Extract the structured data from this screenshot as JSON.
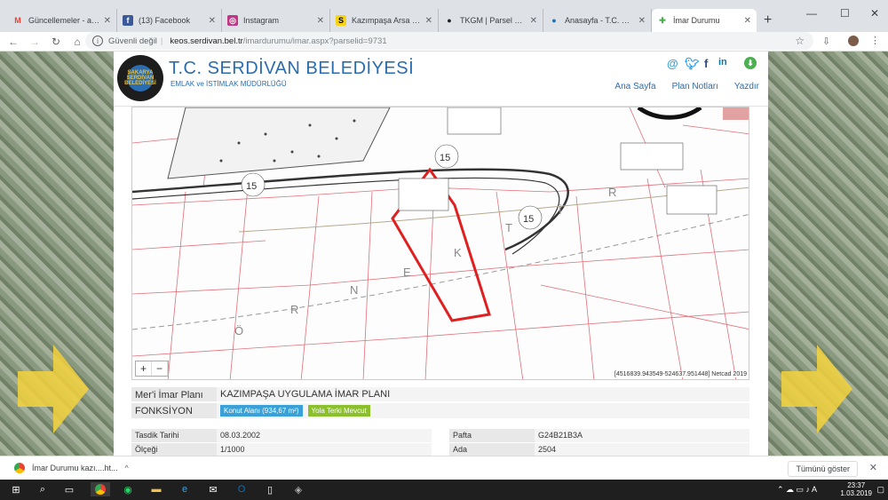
{
  "tabs": [
    {
      "title": "Güncellemeler - alidu",
      "icon": "gmail-icon",
      "icon_glyph": "M",
      "icon_color": "#ea4335"
    },
    {
      "title": "(13) Facebook",
      "icon": "facebook-icon",
      "icon_glyph": "f",
      "icon_color": "#3b5998"
    },
    {
      "title": "Instagram",
      "icon": "instagram-icon",
      "icon_glyph": "◎",
      "icon_color": "#c13584"
    },
    {
      "title": "Kazımpaşa Arsa İlanları",
      "icon": "sahibinden-icon",
      "icon_glyph": "S",
      "icon_color": "#f7d316"
    },
    {
      "title": "TKGM | Parsel Sorgula",
      "icon": "map-pin-icon",
      "icon_glyph": "●",
      "icon_color": "#202124"
    },
    {
      "title": "Anasayfa - T.C. Serdiv",
      "icon": "serdivan-icon",
      "icon_glyph": "●",
      "icon_color": "#2b6cae"
    },
    {
      "title": "İmar Durumu",
      "icon": "netcad-icon",
      "icon_glyph": "✚",
      "icon_color": "#4caf50"
    }
  ],
  "address": {
    "security": "Güvenli değil",
    "host": "keos.serdivan.bel.tr",
    "path": "/imardurumu/imar.aspx?parselid=9731"
  },
  "header": {
    "title": "T.C. SERDİVAN BELEDİYESİ",
    "subtitle": "EMLAK ve İSTİMLAK MÜDÜRLÜĞÜ",
    "logo_text": "SAKARYA SERDİVAN BELEDİYESİ",
    "nav": [
      "Ana Sayfa",
      "Plan Notları",
      "Yazdır"
    ]
  },
  "map": {
    "labels": [
      "Ö",
      "R",
      "N",
      "E",
      "K",
      "T",
      "İ",
      "R"
    ],
    "road_label": "15",
    "coords": "[4516839.943549-524637.951448] Netcad 2019",
    "zoom_in": "+",
    "zoom_out": "−",
    "parcel_color": "#e02020"
  },
  "plan": {
    "plan_label": "Mer'i İmar Planı",
    "plan_value": "KAZIMPAŞA UYGULAMA İMAR PLANI",
    "function_label": "FONKSİYON",
    "function_badges": [
      "Konut Alanı (934,67 m²)",
      "Yola Terki Mevcut"
    ]
  },
  "details": {
    "left": [
      {
        "label": "Tasdik Tarihi",
        "value": "08.03.2002"
      },
      {
        "label": "Ölçeği",
        "value": "1/1000"
      }
    ],
    "right": [
      {
        "label": "Pafta",
        "value": "G24B21B3A"
      },
      {
        "label": "Ada",
        "value": "2504"
      }
    ]
  },
  "download": {
    "file": "İmar Durumu kazı....ht...",
    "show_all": "Tümünü göster"
  },
  "clock": {
    "time": "23:37",
    "date": "1.03.2019"
  }
}
